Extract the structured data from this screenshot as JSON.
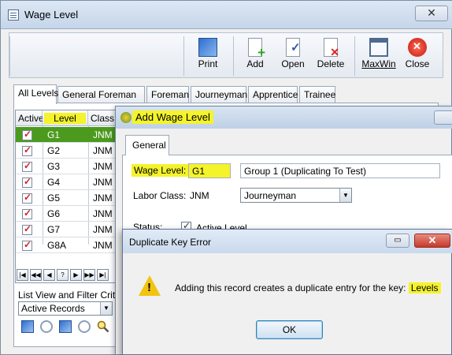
{
  "main": {
    "title": "Wage Level",
    "close_glyph": "✕",
    "toolbar": [
      {
        "label": "Print",
        "icon": "print-icon"
      },
      {
        "label": "Add",
        "icon": "add-icon"
      },
      {
        "label": "Open",
        "icon": "open-icon"
      },
      {
        "label": "Delete",
        "icon": "delete-icon"
      },
      {
        "label": "MaxWin",
        "icon": "maxwin-icon"
      },
      {
        "label": "Close",
        "icon": "close-icon"
      }
    ],
    "tabs": [
      "All Levels",
      "General Foreman",
      "Foreman",
      "Journeyman",
      "Apprentice",
      "Trainee"
    ],
    "grid": {
      "headers": [
        "Active",
        "Level",
        "Class"
      ],
      "rows": [
        {
          "active": true,
          "level": "G1",
          "class": "JNM",
          "selected": true
        },
        {
          "active": true,
          "level": "G2",
          "class": "JNM"
        },
        {
          "active": true,
          "level": "G3",
          "class": "JNM"
        },
        {
          "active": true,
          "level": "G4",
          "class": "JNM"
        },
        {
          "active": true,
          "level": "G5",
          "class": "JNM"
        },
        {
          "active": true,
          "level": "G6",
          "class": "JNM"
        },
        {
          "active": true,
          "level": "G7",
          "class": "JNM"
        },
        {
          "active": true,
          "level": "G8A",
          "class": "JNM"
        }
      ]
    },
    "nav_buttons": [
      "|◀",
      "◀◀",
      "◀",
      "?",
      "▶",
      "▶▶",
      "▶|"
    ],
    "filter_label": "List View and Filter Criteria",
    "filter_value": "Active Records"
  },
  "wage_dialog": {
    "title": "Add Wage Level",
    "tab": "General",
    "wage_level_label": "Wage Level:",
    "wage_level_value": "G1",
    "description_value": "Group 1 (Duplicating To Test)",
    "labor_class_label": "Labor Class:",
    "labor_class_code": "JNM",
    "labor_class_value": "Journeyman",
    "status_label": "Status:",
    "active_label": "Active Level"
  },
  "error_dialog": {
    "title": "Duplicate Key Error",
    "message": "Adding this record creates a duplicate entry for the key:",
    "key": "Levels",
    "ok_label": "OK"
  },
  "highlight_color": "#f4f32c",
  "selection_color": "#4b9a1d"
}
